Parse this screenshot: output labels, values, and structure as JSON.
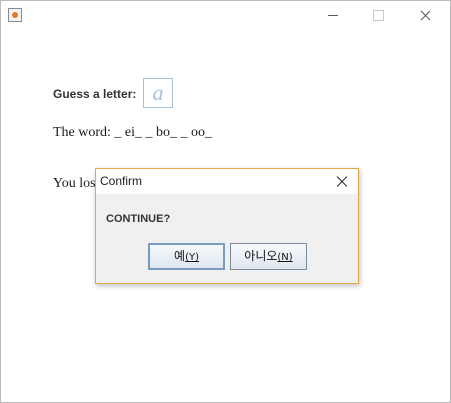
{
  "window": {
    "title": "",
    "icon": "java-icon"
  },
  "game": {
    "guess_label": "Guess a letter:",
    "guess_value": "a",
    "word_line": "The word: _ ei_ _ bo_ _ oo_",
    "lose_line": "You los"
  },
  "dialog": {
    "title": "Confirm",
    "message": "CONTINUE?",
    "yes_text": "예",
    "yes_mnemonic": "(Y)",
    "no_text": "아니오",
    "no_mnemonic": "(N)"
  }
}
